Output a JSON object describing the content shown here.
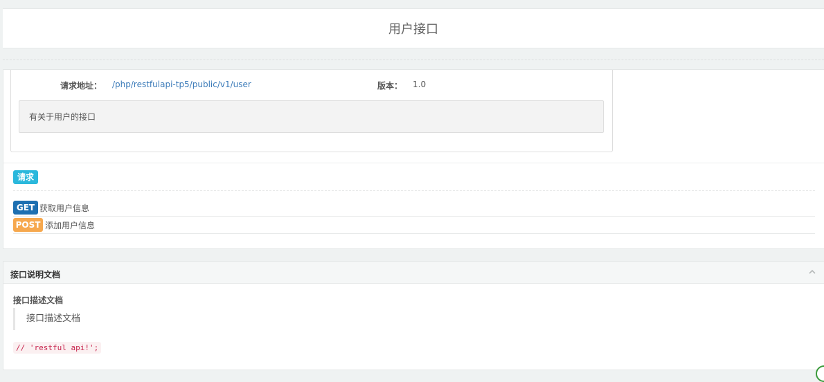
{
  "header": {
    "title": "用户接口"
  },
  "info": {
    "url_label": "请求地址：",
    "url": "/php/restfulapi-tp5/public/v1/user",
    "version_label": "版本：",
    "version": "1.0",
    "description": "有关于用户的接口"
  },
  "request": {
    "label": "请求",
    "methods": [
      {
        "method": "GET",
        "text": "获取用户信息",
        "color": "#1d6fb1"
      },
      {
        "method": "POST",
        "text": "添加用户信息",
        "color": "#f6a84e"
      }
    ]
  },
  "doc_panel": {
    "title": "接口说明文档",
    "subtitle": "接口描述文档",
    "quote": "接口描述文档",
    "code": "// 'restful api!';",
    "collapse_icon": "chevron-up-icon"
  },
  "colors": {
    "accent_request": "#2bb8dc",
    "link": "#3a7ab8",
    "code_text": "#c7254e"
  }
}
